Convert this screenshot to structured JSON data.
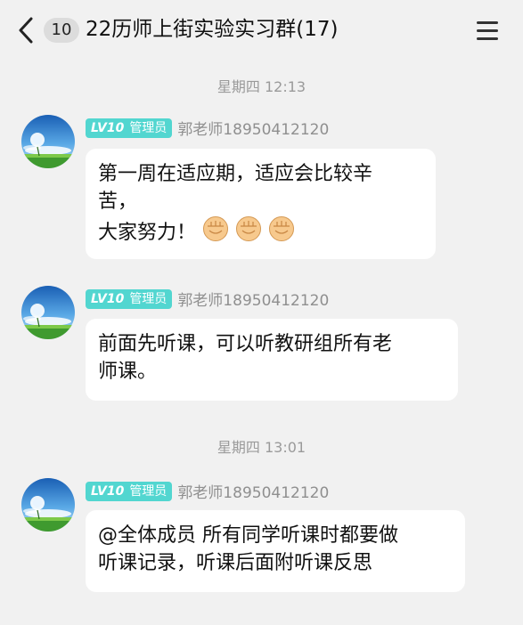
{
  "header": {
    "unread_count": "10",
    "title": "22历师上街实验实习群(17)"
  },
  "colors": {
    "background": "#f1f1f1",
    "bubble": "#ffffff",
    "level_badge": "#52d6d0",
    "fist_emoji": "#f7c98d"
  },
  "messages": [
    {
      "timestamp": "星期四 12:13",
      "level": "LV10",
      "role": "管理员",
      "sender": "郭老师18950412120",
      "lines": [
        "第一周在适应期，适应会比较辛",
        "苦，",
        "大家努力！"
      ],
      "emoji": [
        "fist-icon",
        "fist-icon",
        "fist-icon"
      ]
    },
    {
      "level": "LV10",
      "role": "管理员",
      "sender": "郭老师18950412120",
      "lines": [
        "前面先听课，可以听教研组所有老",
        "师课。"
      ]
    },
    {
      "timestamp": "星期四 13:01",
      "level": "LV10",
      "role": "管理员",
      "sender": "郭老师18950412120",
      "lines": [
        "@全体成员 所有同学听课时都要做",
        "听课记录，听课后面附听课反思"
      ]
    }
  ]
}
